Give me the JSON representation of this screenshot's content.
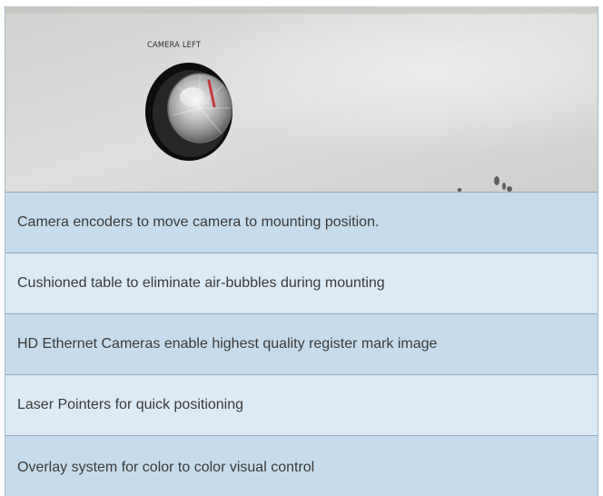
{
  "photo": {
    "label": "CAMERA LEFT"
  },
  "features": [
    {
      "text": "Camera encoders to move camera to mounting position."
    },
    {
      "text": "Cushioned table to eliminate air-bubbles during mounting"
    },
    {
      "text": "HD Ethernet Cameras enable highest quality register mark image"
    },
    {
      "text": "Laser Pointers for quick positioning"
    },
    {
      "text": "Overlay system for color to color visual control"
    }
  ],
  "colors": {
    "row_dark": "#c6dcec",
    "row_light": "#dceaf5",
    "divider": "#8fa9bd",
    "text": "#3a3a3a"
  }
}
